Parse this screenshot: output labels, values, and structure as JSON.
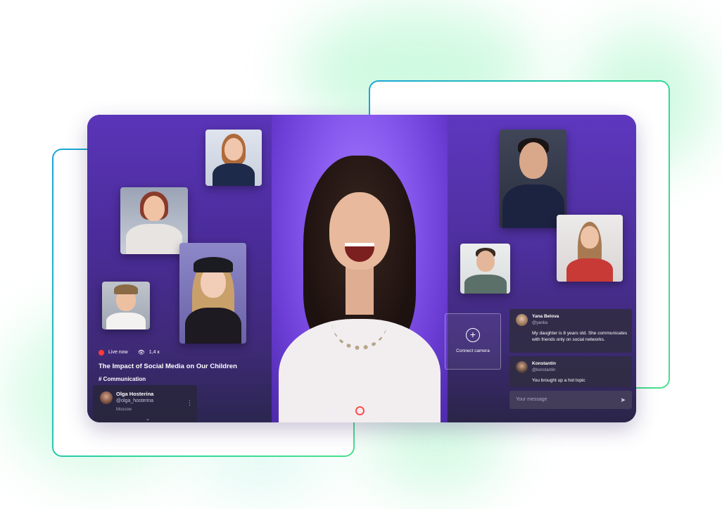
{
  "stream": {
    "live_label": "Live now",
    "viewers": "1,4 к",
    "title": "The Impact of Social Media on Our Children",
    "tag": "# Communication"
  },
  "host": {
    "name": "Olga Hosterina",
    "handle": "@olga_hosterina",
    "city": "Moscow"
  },
  "connect_camera": {
    "label": "Connect camera"
  },
  "chat": {
    "messages": [
      {
        "name": "Yana Belova",
        "handle": "@yanka",
        "text": "My daughter is 8 years old. She communicates with friends only on social networks."
      },
      {
        "name": "Konstantin",
        "handle": "@konstantin",
        "text": "You brought up a hot topic"
      }
    ],
    "input_placeholder": "Your message"
  },
  "icons": {
    "live": "live-dot-icon",
    "viewers": "eye-icon",
    "volume": "volume-icon",
    "record": "record-icon",
    "fullscreen": "fullscreen-icon",
    "more": "more-vertical-icon",
    "add": "plus-circle-icon",
    "send": "send-icon"
  },
  "colors": {
    "accent_purple": "#6c3ed6",
    "live_red": "#ff3b3b",
    "frame_gradient_start": "#1aa4d8",
    "frame_gradient_end": "#48e08a"
  }
}
